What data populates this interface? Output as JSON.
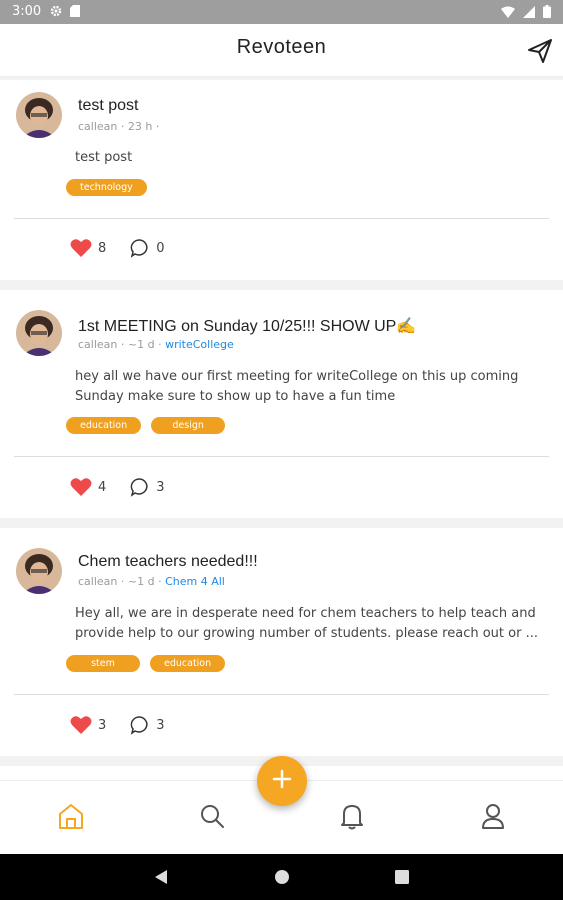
{
  "status_bar": {
    "time": "3:00"
  },
  "app": {
    "title": "Revoteen"
  },
  "posts": [
    {
      "title": "test post",
      "author": "callean",
      "time": "23 h",
      "group": "",
      "body": "test post",
      "tags": [
        "technology"
      ],
      "likes": "8",
      "comments": "0"
    },
    {
      "title": "1st MEETING on Sunday 10/25!!! SHOW UP✍️",
      "author": "callean",
      "time": "~1 d",
      "group": "writeCollege",
      "body": "hey all we have our first meeting for writeCollege on this up coming Sunday make sure to show up to have a fun time",
      "tags": [
        "education",
        "design"
      ],
      "likes": "4",
      "comments": "3"
    },
    {
      "title": "Chem teachers needed!!!",
      "author": "callean",
      "time": "~1 d",
      "group": "Chem 4 All",
      "body": "Hey all, we are in desperate need for chem teachers to help teach and provide help to our growing number of students. please reach out or ...",
      "tags": [
        "stem",
        "education"
      ],
      "likes": "3",
      "comments": "3"
    }
  ],
  "colors": {
    "accent": "#f5a623",
    "tag": "#f0a020",
    "heart": "#ef4a4a",
    "link": "#1e88e5"
  },
  "nav": {
    "active": "home",
    "items": [
      "home",
      "search",
      "notifications",
      "profile"
    ]
  }
}
